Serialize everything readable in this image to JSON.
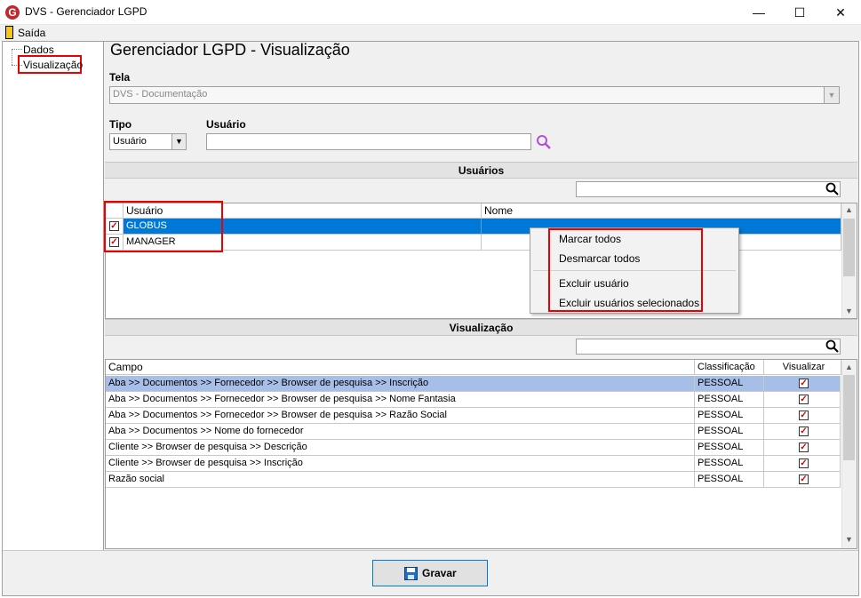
{
  "window": {
    "title": "DVS - Gerenciador LGPD",
    "app_icon_glyph": "G"
  },
  "menu": {
    "exit_label": "Saída"
  },
  "tree": {
    "items": [
      "Dados",
      "Visualização"
    ]
  },
  "page_title": "Gerenciador LGPD - Visualização",
  "tela": {
    "label": "Tela",
    "value": "DVS - Documentação"
  },
  "tipo": {
    "label": "Tipo",
    "value": "Usuário"
  },
  "usuario": {
    "label": "Usuário",
    "value": ""
  },
  "users_section": {
    "title": "Usuários",
    "search_value": "",
    "columns": [
      "Usuário",
      "Nome"
    ],
    "rows": [
      {
        "usuario": "GLOBUS",
        "nome": "",
        "checked": true,
        "selected": true
      },
      {
        "usuario": "MANAGER",
        "nome": "",
        "checked": true,
        "selected": false
      }
    ]
  },
  "context_menu": {
    "items": [
      "Marcar todos",
      "Desmarcar todos",
      "Excluir usuário",
      "Excluir usuários selecionados"
    ]
  },
  "view_section": {
    "title": "Visualização",
    "search_value": "",
    "columns": [
      "Campo",
      "Classificação",
      "Visualizar"
    ],
    "rows": [
      {
        "campo": "Aba >> Documentos  >> Fornecedor >> Browser de pesquisa >> Inscrição",
        "classificacao": "PESSOAL",
        "visualizar": true
      },
      {
        "campo": "Aba >> Documentos  >> Fornecedor >> Browser de pesquisa >> Nome Fantasia",
        "classificacao": "PESSOAL",
        "visualizar": true
      },
      {
        "campo": "Aba >> Documentos  >> Fornecedor >> Browser de pesquisa >> Razão Social",
        "classificacao": "PESSOAL",
        "visualizar": true
      },
      {
        "campo": "Aba >> Documentos  >> Nome do fornecedor",
        "classificacao": "PESSOAL",
        "visualizar": true
      },
      {
        "campo": "Cliente >> Browser de pesquisa >> Descrição",
        "classificacao": "PESSOAL",
        "visualizar": true
      },
      {
        "campo": "Cliente >> Browser de pesquisa >> Inscrição",
        "classificacao": "PESSOAL",
        "visualizar": true
      },
      {
        "campo": "Razão social",
        "classificacao": "PESSOAL",
        "visualizar": true
      }
    ]
  },
  "save_button": {
    "label": "Gravar"
  },
  "colors": {
    "selection": "#0078d7",
    "row_highlight": "#a7bfe8",
    "annotation_red": "#e00000",
    "brand_red": "#c0282d"
  },
  "icons": [
    "app-logo-icon",
    "exit-door-icon",
    "search-icon",
    "dropdown-arrow-icon",
    "save-disk-icon",
    "checkbox-checked-icon"
  ]
}
